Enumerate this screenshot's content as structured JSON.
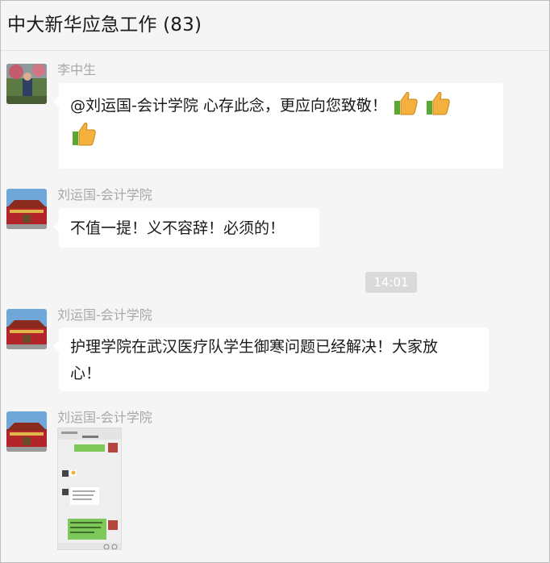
{
  "header": {
    "title": "中大新华应急工作 (83)"
  },
  "messages": [
    {
      "sender": "李中生",
      "text": "@刘运国-会计学院 心存此念，更应向您致敬！",
      "emoji": [
        "thumbs-up-icon",
        "thumbs-up-icon",
        "thumbs-up-icon"
      ]
    },
    {
      "sender": "刘运国-会计学院",
      "text": "不值一提！义不容辞！必须的！"
    },
    {
      "time": "14:01"
    },
    {
      "sender": "刘运国-会计学院",
      "text_line1": "护理学院在武汉医疗队学生御寒问题已经解决！大家放",
      "text_line2": "心！"
    },
    {
      "sender": "刘运国-会计学院",
      "image": "chat-screenshot-thumbnail"
    }
  ],
  "colors": {
    "bubble": "#ffffff",
    "background": "#f5f5f5",
    "sender": "#a8a8a8",
    "time_badge": "#dadada"
  }
}
